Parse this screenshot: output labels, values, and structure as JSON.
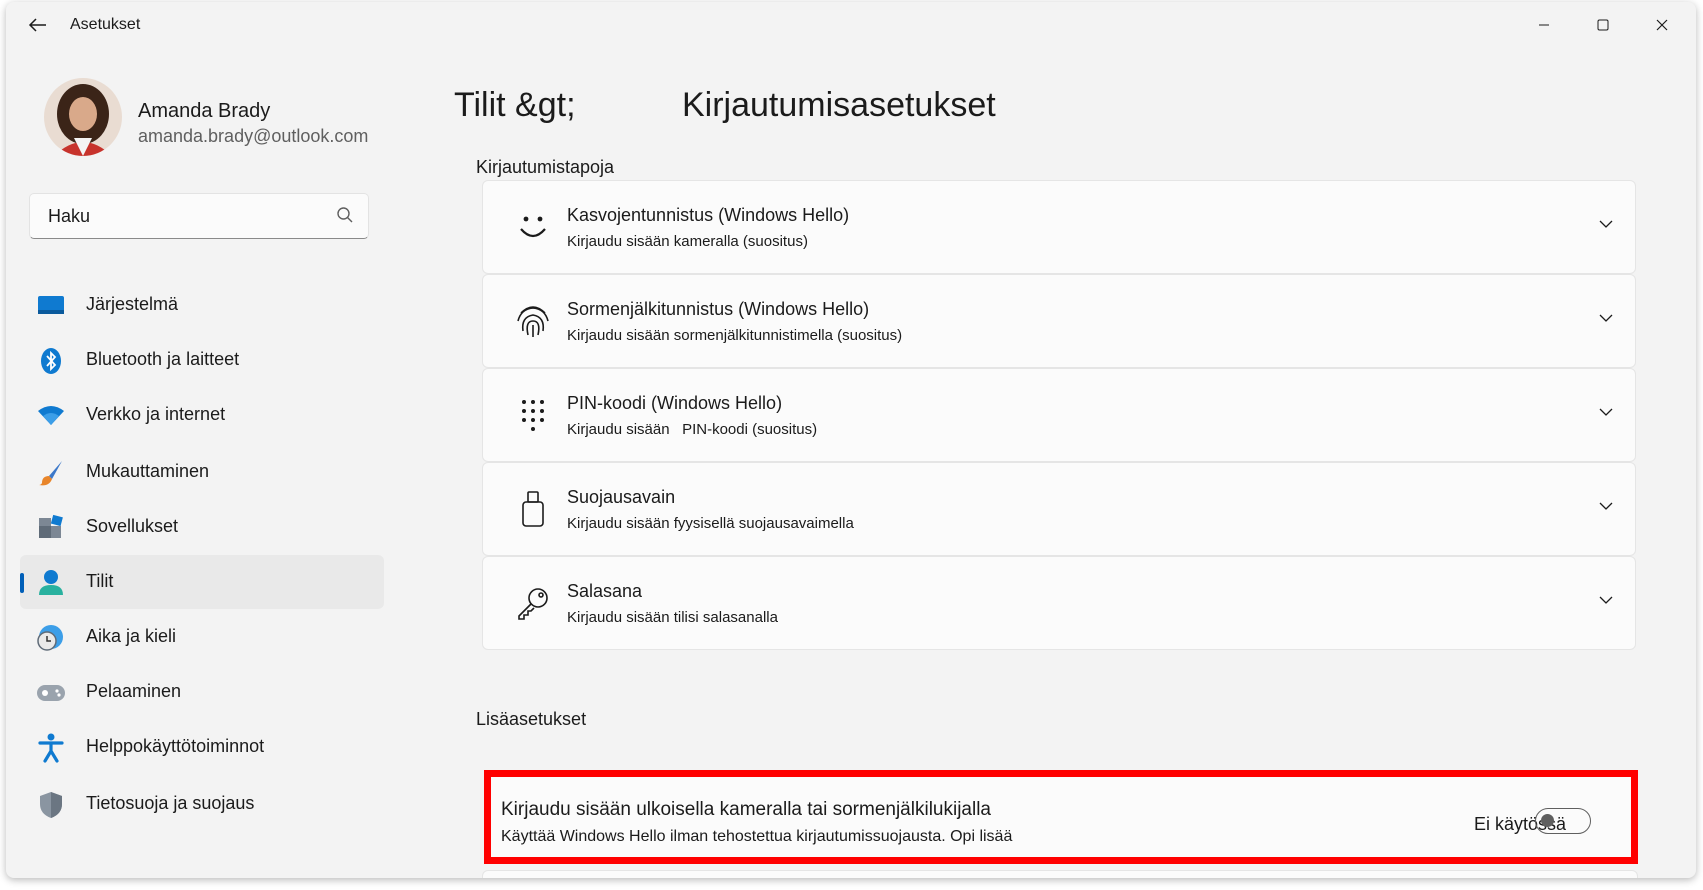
{
  "titlebar": {
    "app_title": "Asetukset"
  },
  "profile": {
    "name": "Amanda Brady",
    "email": "amanda.brady@outlook.com"
  },
  "search": {
    "placeholder": "Haku"
  },
  "nav": [
    {
      "label": "Järjestelmä",
      "icon": "monitor-icon"
    },
    {
      "label": "Bluetooth ja laitteet",
      "icon": "bluetooth-icon"
    },
    {
      "label": "Verkko ja internet",
      "icon": "wifi-icon"
    },
    {
      "label": "Mukauttaminen",
      "icon": "brush-icon"
    },
    {
      "label": "Sovellukset",
      "icon": "apps-icon"
    },
    {
      "label": "Tilit",
      "icon": "person-icon",
      "active": true
    },
    {
      "label": "Aika ja kieli",
      "icon": "globe-clock-icon"
    },
    {
      "label": "Pelaaminen",
      "icon": "gamepad-icon"
    },
    {
      "label": "Helppokäyttötoiminnot",
      "icon": "accessibility-icon"
    },
    {
      "label": "Tietosuoja ja suojaus",
      "icon": "shield-icon"
    }
  ],
  "breadcrumb": {
    "parent": "Tilit &gt;",
    "current": "Kirjautumisasetukset"
  },
  "sections": {
    "signin_methods": "Kirjautumistapoja",
    "additional": "Lisäasetukset"
  },
  "methods": [
    {
      "title": "Kasvojentunnistus (Windows Hello)",
      "subtitle": "Kirjaudu sisään kameralla (suositus)",
      "icon": "face-icon"
    },
    {
      "title": "Sormenjälkitunnistus (Windows Hello)",
      "subtitle": "Kirjaudu sisään sormenjälkitunnistimella (suositus)",
      "icon": "fingerprint-icon"
    },
    {
      "title": "PIN-koodi (Windows Hello)",
      "subtitle": "Kirjaudu sisään   PIN-koodi (suositus)",
      "icon": "keypad-icon"
    },
    {
      "title": "Suojausavain",
      "subtitle": "Kirjaudu sisään fyysisellä suojausavaimella",
      "icon": "usb-key-icon"
    },
    {
      "title": "Salasana",
      "subtitle": "Kirjaudu sisään tilisi salasanalla",
      "icon": "key-icon"
    }
  ],
  "additional_setting": {
    "title": "Kirjaudu sisään ulkoisella kameralla tai sormenjälkilukijalla",
    "subtitle": "Käyttää Windows Hello ilman tehostettua kirjautumissuojausta. Opi lisää",
    "status": "Ei käytössä",
    "toggle_on": false
  },
  "colors": {
    "accent": "#005fb8",
    "highlight": "#ff0000",
    "background": "#f3f3f3"
  }
}
